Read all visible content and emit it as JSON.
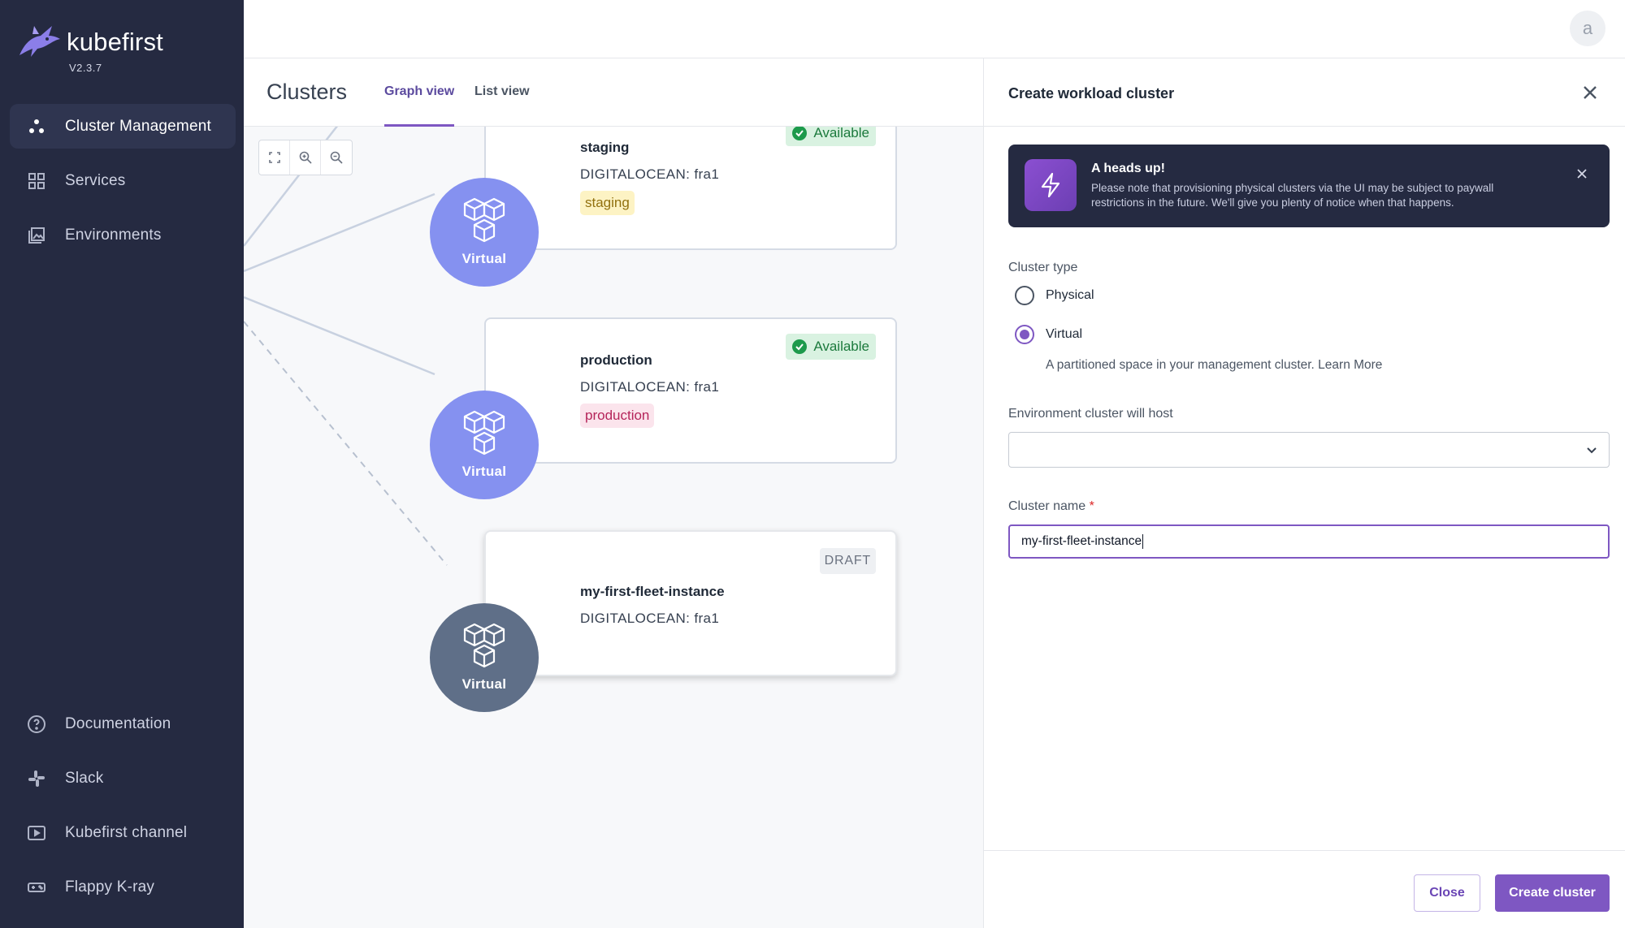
{
  "app": {
    "name": "kubefirst",
    "version": "V2.3.7",
    "user_initial": "a"
  },
  "sidebar": {
    "primary": [
      {
        "label": "Cluster Management",
        "icon": "cluster-management-icon",
        "active": true
      },
      {
        "label": "Services",
        "icon": "services-grid-icon",
        "active": false
      },
      {
        "label": "Environments",
        "icon": "environments-icon",
        "active": false
      }
    ],
    "secondary": [
      {
        "label": "Documentation",
        "icon": "help-circle-icon"
      },
      {
        "label": "Slack",
        "icon": "slack-icon"
      },
      {
        "label": "Kubefirst channel",
        "icon": "youtube-icon"
      },
      {
        "label": "Flappy K-ray",
        "icon": "gamepad-icon"
      }
    ]
  },
  "clusters": {
    "title": "Clusters",
    "tabs": [
      {
        "label": "Graph view",
        "active": true
      },
      {
        "label": "List view",
        "active": false
      }
    ],
    "cards": [
      {
        "name": "staging",
        "location": "DIGITALOCEAN: fra1",
        "tag": "staging",
        "status": "Available",
        "node_label": "Virtual"
      },
      {
        "name": "production",
        "location": "DIGITALOCEAN: fra1",
        "tag": "production",
        "status": "Available",
        "node_label": "Virtual"
      },
      {
        "name": "my-first-fleet-instance",
        "location": "DIGITALOCEAN: fra1",
        "status": "DRAFT",
        "node_label": "Virtual"
      }
    ]
  },
  "panel": {
    "title": "Create workload cluster",
    "alert": {
      "title": "A heads up!",
      "body": "Please note that provisioning physical clusters via the UI may be subject to paywall restrictions in the future. We'll give you plenty of notice when that happens."
    },
    "cluster_type": {
      "label": "Cluster type",
      "options": [
        "Physical",
        "Virtual"
      ],
      "selected": "Virtual",
      "helper": "A partitioned space in your management cluster. Learn More"
    },
    "environment": {
      "label": "Environment cluster will host",
      "value": ""
    },
    "cluster_name": {
      "label": "Cluster name",
      "required_mark": "*",
      "value": "my-first-fleet-instance"
    },
    "buttons": {
      "close": "Close",
      "create": "Create cluster"
    }
  },
  "colors": {
    "sidebar_bg": "#252a41",
    "accent": "#7e57c2",
    "node_virtual": "#8591f0",
    "node_draft": "#5f6f88",
    "available_bg": "#d9f2e1",
    "available_text": "#1c7a3d"
  }
}
